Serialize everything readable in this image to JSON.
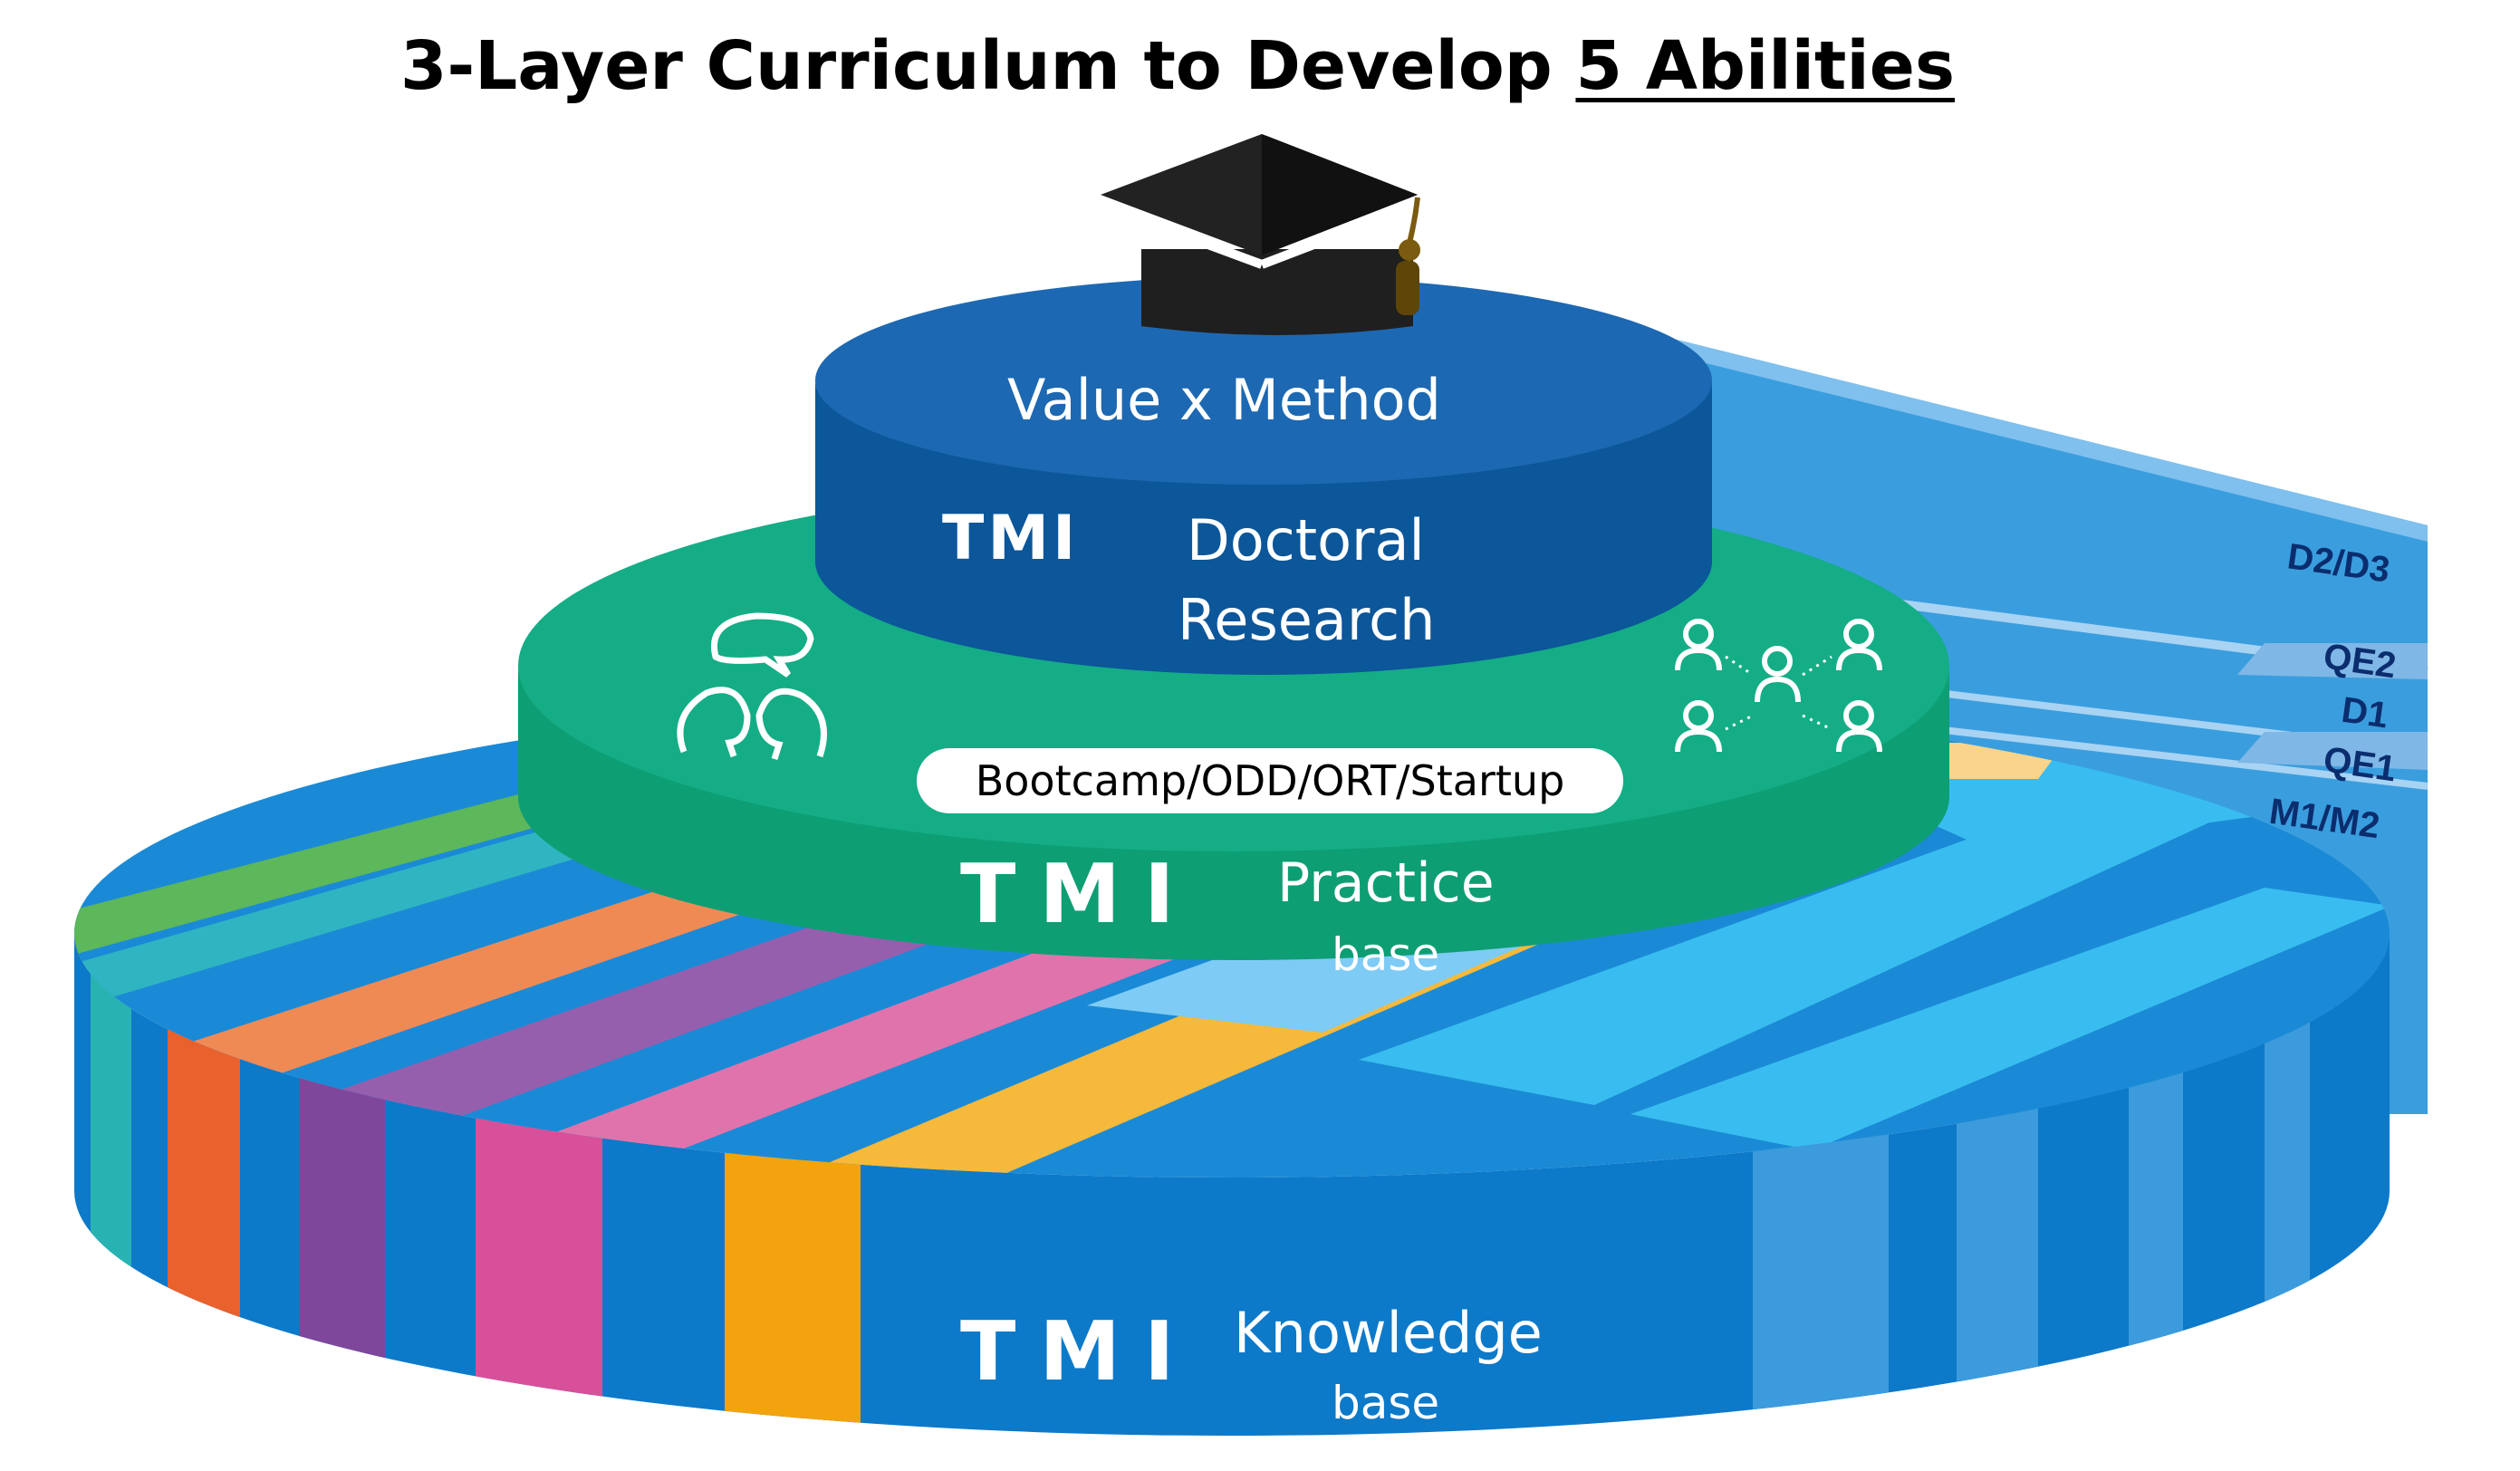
{
  "title": {
    "main": "3-Layer Curriculum to Develop",
    "underlined": "5 Abilities"
  },
  "layers": {
    "top": {
      "heading": "Value x Method",
      "logo": "TMI",
      "label_line1": "Doctoral",
      "label_line2": "Research",
      "color": "#1660a8"
    },
    "middle": {
      "logo": "TMI",
      "label_line1": "Practice",
      "label_line2": "base",
      "pill_text": "Bootcamp/ODD/ORT/Startup",
      "color": "#10a884",
      "icons": [
        "discussion-icon",
        "team-network-icon"
      ]
    },
    "bottom": {
      "logo": "TMI",
      "label_line1": "Knowledge",
      "label_line2": "base",
      "color": "#0d79c9"
    }
  },
  "stages": [
    "D2/D3",
    "QE2",
    "D1",
    "QE1",
    "M1/M2"
  ],
  "icons": {
    "cap": "graduation-cap-icon"
  }
}
